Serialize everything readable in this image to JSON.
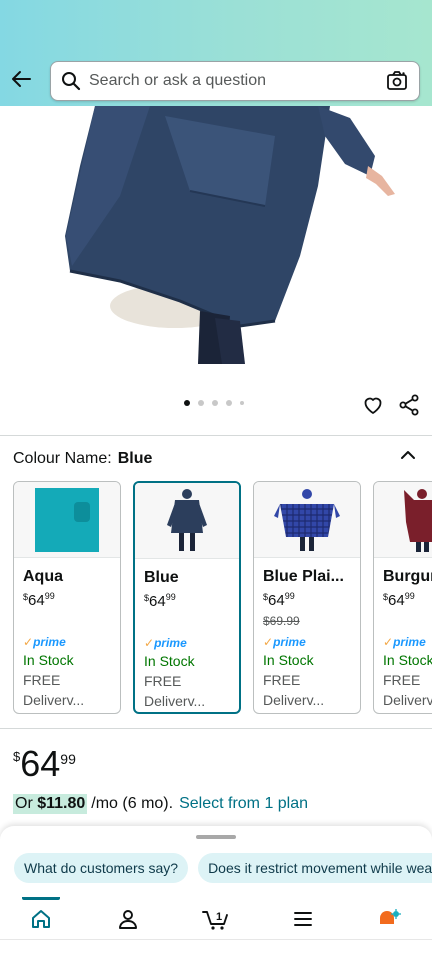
{
  "header": {
    "search_placeholder": "Search or ask a question"
  },
  "gallery": {
    "image_count": 5,
    "active_index": 0
  },
  "colour": {
    "label": "Colour Name:",
    "value": "Blue"
  },
  "swatches": [
    {
      "name": "Aqua",
      "dollar": "$",
      "price_whole": "64",
      "price_frac": "99",
      "was": "",
      "prime": "prime",
      "stock": "In Stock",
      "free": "FREE",
      "delivery": "Deliverv..."
    },
    {
      "name": "Blue",
      "dollar": "$",
      "price_whole": "64",
      "price_frac": "99",
      "was": "",
      "prime": "prime",
      "stock": "In Stock",
      "free": "FREE",
      "delivery": "Deliverv..."
    },
    {
      "name": "Blue Plai...",
      "dollar": "$",
      "price_whole": "64",
      "price_frac": "99",
      "was": "$69.99",
      "prime": "prime",
      "stock": "In Stock",
      "free": "FREE",
      "delivery": "Deliverv..."
    },
    {
      "name": "Burgur",
      "dollar": "$",
      "price_whole": "64",
      "price_frac": "99",
      "was": "",
      "prime": "prime",
      "stock": "In Stock",
      "free": "FREE",
      "delivery": "Deliverv"
    }
  ],
  "price": {
    "currency": "$",
    "whole": "64",
    "fraction": "99"
  },
  "plan": {
    "prefix": "Or ",
    "amount": "$11.80",
    "term": "/mo (6 mo).",
    "link": "Select from 1 plan"
  },
  "chips": [
    "What do customers say?",
    "Does it restrict movement while wear"
  ],
  "colors": {
    "accent": "#007185",
    "in_stock": "#007600",
    "prime": "#1a98ff",
    "chip_bg": "#ddf3f6"
  },
  "nav_icons": [
    "home-icon",
    "profile-icon",
    "cart-icon",
    "menu-icon",
    "rufus-icon"
  ],
  "cart_count": "1"
}
